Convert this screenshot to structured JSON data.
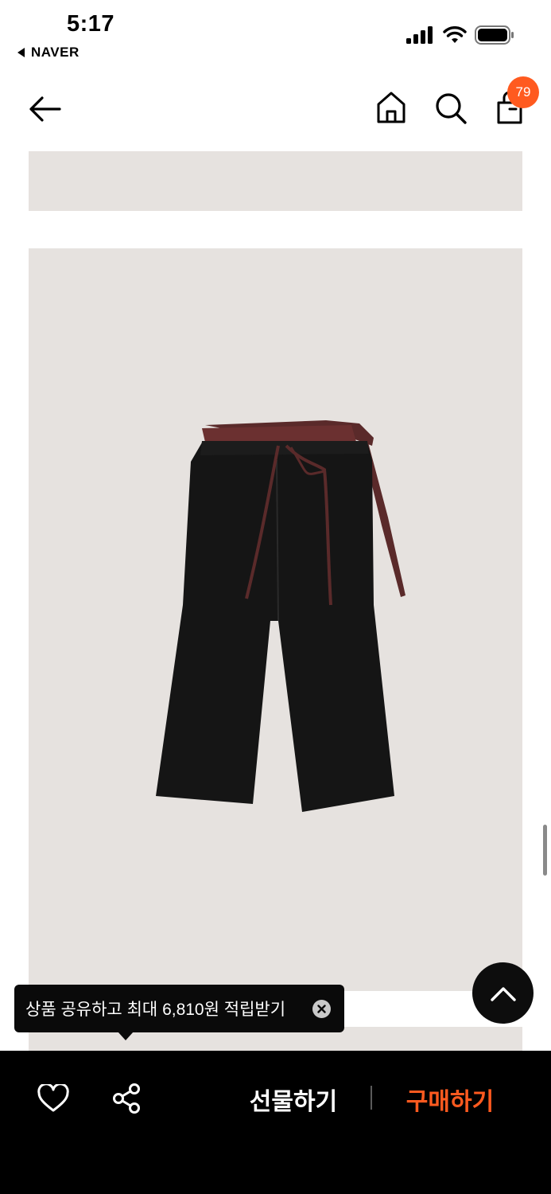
{
  "status_bar": {
    "time": "5:17",
    "back_app": "NAVER",
    "icons": [
      "cellular-signal-icon",
      "wifi-icon",
      "battery-icon"
    ]
  },
  "header": {
    "icons": [
      "back-arrow-icon",
      "home-icon",
      "search-icon",
      "shopping-bag-icon"
    ],
    "cart_count": "79"
  },
  "product": {
    "image_background": "#e6e2df",
    "image_subject": "pants-icon"
  },
  "toast": {
    "message": "상품 공유하고 최대 6,810원 적립받기"
  },
  "bottom_bar": {
    "gift_label": "선물하기",
    "buy_label": "구매하기",
    "icons": [
      "heart-icon",
      "share-icon"
    ]
  },
  "colors": {
    "accent": "#ff5a1f",
    "bottom_bar_bg": "#000000"
  }
}
